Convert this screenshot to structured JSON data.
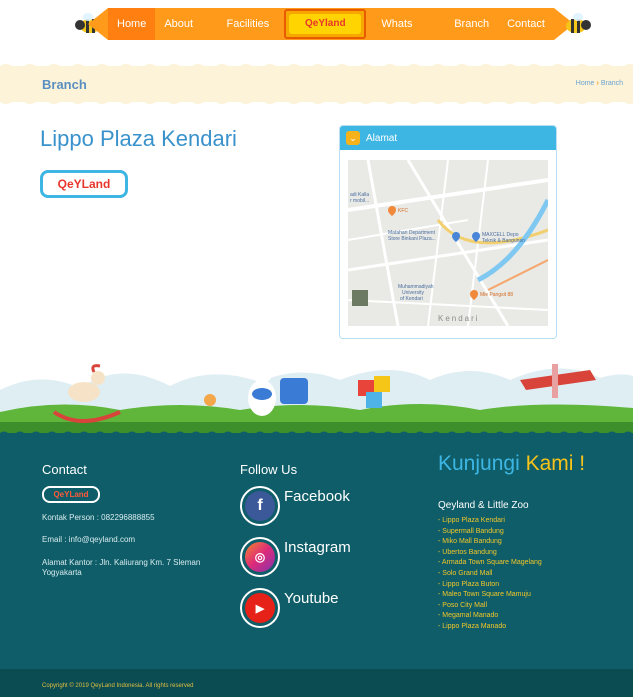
{
  "nav": {
    "items": [
      {
        "label": "Home"
      },
      {
        "label": "About Us"
      },
      {
        "label": "Facilities"
      },
      {
        "label": "Whats New"
      },
      {
        "label": "Branch"
      },
      {
        "label": "Contact"
      }
    ],
    "logo_text": "QeYland",
    "accent": "#ff9a1a",
    "active": "#ff7f11"
  },
  "breadcrumb": {
    "title": "Branch",
    "home": "Home",
    "current": "Branch"
  },
  "main": {
    "branch_name": "Lippo Plaza Kendari",
    "logo_text": "QeYLand",
    "alamat_label": "Alamat",
    "map_labels": {
      "kalla": "adi Kalla",
      "kalla2": "r mobil...",
      "kfc": "KFC",
      "matahari1": "Matahari Department",
      "matahari2": "Store Binkani Plaza...",
      "maxcell1": "MAXCELL Depo",
      "maxcell2": "Teknik & Bangunan",
      "univ1": "Muhammadiyah",
      "univ2": "University",
      "univ3": "of Kendari",
      "pangsit": "Mie Pangsit 88",
      "kendari": "Kendari"
    }
  },
  "footer": {
    "contact": {
      "title": "Contact",
      "logo_text": "QeYLand",
      "person": "Kontak Person : 082296888855",
      "email": "Email : info@qeyland.com",
      "address_line1": "Alamat Kantor : Jln. Kaliurang Km. 7 Sleman",
      "address_line2": "Yogyakarta"
    },
    "follow": {
      "title": "Follow Us",
      "items": [
        {
          "label": "Facebook",
          "icon": "facebook-icon"
        },
        {
          "label": "Instagram",
          "icon": "instagram-icon"
        },
        {
          "label": "Youtube",
          "icon": "youtube-icon"
        }
      ]
    },
    "kunjungi": {
      "word1": "Kunjungi",
      "word2": "Kami !",
      "zoo_title": "Qeyland & Little Zoo",
      "branches": [
        "- Lippo Plaza Kendari",
        "- Supermall Bandung",
        "- Miko Mall Bandung",
        "- Ubertos Bandung",
        "- Armada Town Square Magelang",
        "- Solo Grand Mall",
        "- Lippo Plaza Buton",
        "- Maleo Town Square Mamuju",
        "- Poso City Mall",
        "- Megamal Manado",
        "- Lippo Plaza Manado"
      ]
    },
    "copyright": "Copyright © 2019 QeyLand Indonesia. All rights reserved"
  }
}
